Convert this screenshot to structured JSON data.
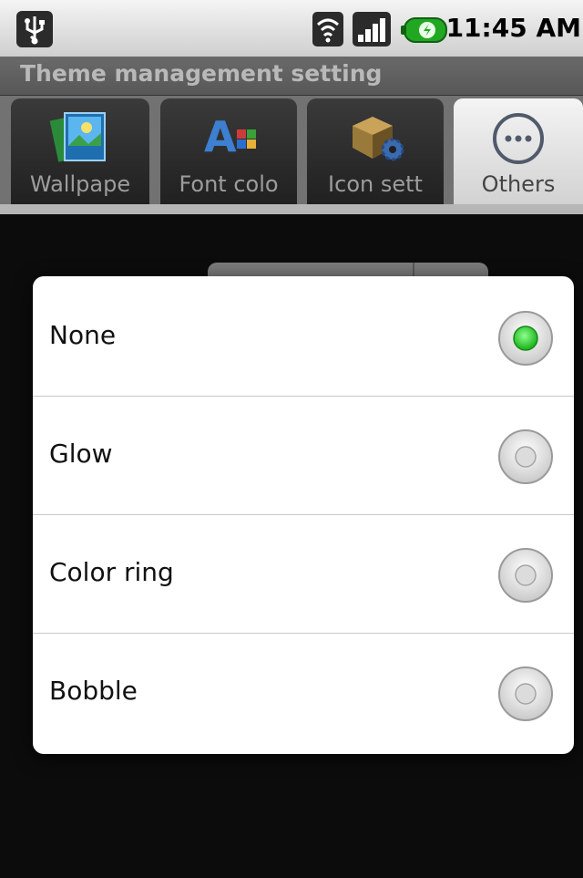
{
  "status_bar": {
    "time": "11:45 AM"
  },
  "app": {
    "title": "Theme management setting"
  },
  "tabs": [
    {
      "label": "Wallpape",
      "icon": "wallpaper-icon",
      "active": false
    },
    {
      "label": "Font colo",
      "icon": "font-color-icon",
      "active": false
    },
    {
      "label": "Icon sett",
      "icon": "icon-settings-icon",
      "active": false
    },
    {
      "label": "Others",
      "icon": "more-icon",
      "active": true
    }
  ],
  "dialog": {
    "options": [
      {
        "label": "None",
        "selected": true
      },
      {
        "label": "Glow",
        "selected": false
      },
      {
        "label": "Color ring",
        "selected": false
      },
      {
        "label": "Bobble",
        "selected": false
      }
    ]
  },
  "colors": {
    "selected_radio": "#2ecc2e",
    "status_bar": "#e0e0e0",
    "title_bar": "#5f5f5f"
  }
}
